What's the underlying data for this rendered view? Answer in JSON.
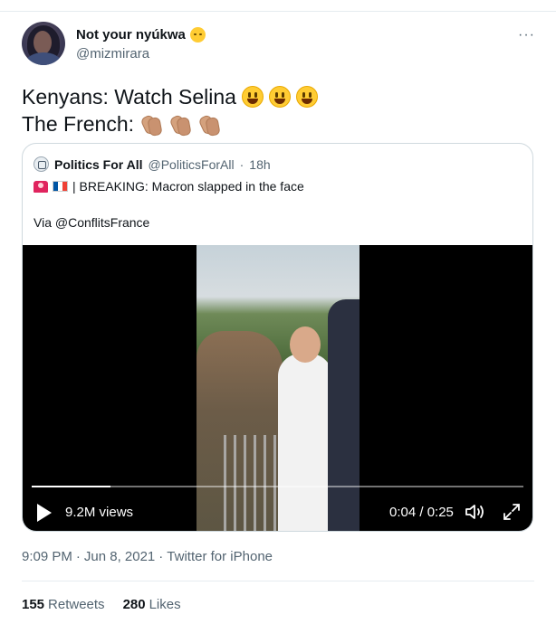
{
  "author": {
    "display_name": "Not your nyúkwa",
    "name_emoji": "relieved-face-emoji",
    "handle": "@mizmirara"
  },
  "menu": {
    "label": "···"
  },
  "tweet": {
    "line1": "Kenyans: Watch Selina",
    "line1_emojis": [
      "grinning-face",
      "grinning-face",
      "grinning-face"
    ],
    "line2": "The French:",
    "line2_emojis": [
      "clapping-hands",
      "clapping-hands",
      "clapping-hands"
    ]
  },
  "quoted_tweet": {
    "display_name": "Politics For All",
    "handle": "@PoliticsForAll",
    "separator": "·",
    "time": "18h",
    "text_line1": "| BREAKING: Macron slapped in the face",
    "text_line2": "Via @ConflitsFrance",
    "flag_colors": [
      "#0055a4",
      "#ffffff",
      "#ef4135"
    ],
    "video": {
      "views": "9.2M views",
      "time": "0:04 / 0:25",
      "progress": 0.16
    }
  },
  "meta": {
    "time": "9:09 PM",
    "sep1": "·",
    "date": "Jun 8, 2021",
    "sep2": "·",
    "source": "Twitter for iPhone"
  },
  "stats": {
    "retweets_count": "155",
    "retweets_label": "Retweets",
    "likes_count": "280",
    "likes_label": "Likes"
  }
}
